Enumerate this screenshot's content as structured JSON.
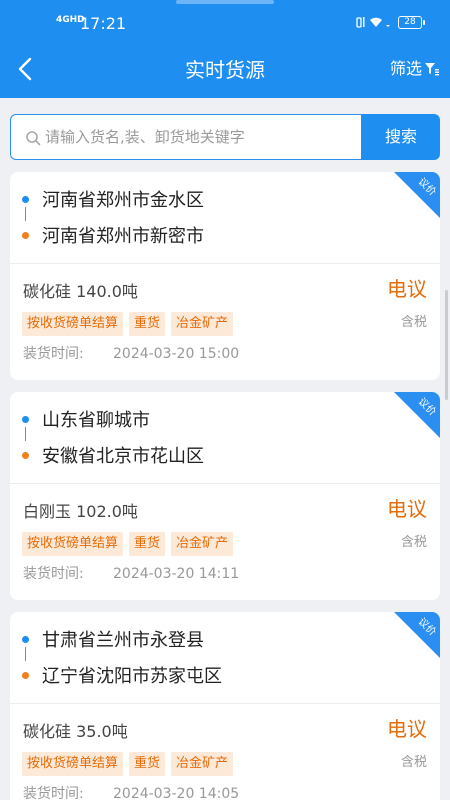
{
  "status_bar": {
    "network": "4GHD",
    "time": "17:21",
    "battery": "28"
  },
  "header": {
    "title": "实时货源",
    "filter_label": "筛选"
  },
  "search": {
    "placeholder": "请输入货名,装、卸货地关键字",
    "button_label": "搜索"
  },
  "ribbon_label": "议价",
  "time_label": "装货时间:",
  "tax_label": "含税",
  "listings": [
    {
      "from": "河南省郑州市金水区",
      "to": "河南省郑州市新密市",
      "goods": "碳化硅 140.0吨",
      "tags": [
        "按收货磅单结算",
        "重货",
        "冶金矿产"
      ],
      "load_time": "2024-03-20 15:00",
      "price": "电议"
    },
    {
      "from": "山东省聊城市",
      "to": "安徽省北京市花山区",
      "goods": "白刚玉 102.0吨",
      "tags": [
        "按收货磅单结算",
        "重货",
        "冶金矿产"
      ],
      "load_time": "2024-03-20 14:11",
      "price": "电议"
    },
    {
      "from": "甘肃省兰州市永登县",
      "to": "辽宁省沈阳市苏家屯区",
      "goods": "碳化硅 35.0吨",
      "tags": [
        "按收货磅单结算",
        "重货",
        "冶金矿产"
      ],
      "load_time": "2024-03-20 14:05",
      "price": "电议"
    }
  ]
}
